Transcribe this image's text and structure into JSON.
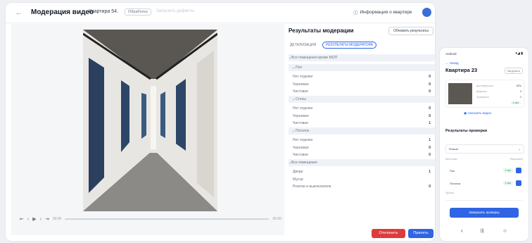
{
  "header": {
    "back_icon": "arrow-left-icon",
    "title": "Модерация видео",
    "breadcrumb": "Квартира 54.",
    "status_chip": "Обработка",
    "faded_text": "Загрузить дефекты",
    "info_label": "Информация о квартире"
  },
  "video": {
    "time_start": "00:00",
    "time_end": "00:00",
    "controls": [
      "⇤",
      "‹",
      "▶",
      "›",
      "⇥"
    ]
  },
  "panel": {
    "title": "Результаты модерации",
    "export_button": "Обновить результаты",
    "tabs": [
      "ДЕТАЛИЗАЦИЯ",
      "РЕЗУЛЬТАТЫ МОДЕРАТОРА"
    ],
    "rows": [
      {
        "label": "Все помещения кроме МОП",
        "value": "",
        "kind": "group"
      },
      {
        "label": "Пол",
        "value": "",
        "kind": "sub"
      },
      {
        "label": "Нет отделки",
        "value": "0",
        "kind": "item"
      },
      {
        "label": "Черновая",
        "value": "0",
        "kind": "item"
      },
      {
        "label": "Чистовая",
        "value": "0",
        "kind": "item"
      },
      {
        "label": "Стены",
        "value": "",
        "kind": "sub"
      },
      {
        "label": "Нет отделки",
        "value": "0",
        "kind": "item"
      },
      {
        "label": "Черновая",
        "value": "0",
        "kind": "item"
      },
      {
        "label": "Чистовая",
        "value": "1",
        "kind": "item"
      },
      {
        "label": "Потолок",
        "value": "",
        "kind": "sub"
      },
      {
        "label": "Нет отделки",
        "value": "1",
        "kind": "item"
      },
      {
        "label": "Черновая",
        "value": "0",
        "kind": "item"
      },
      {
        "label": "Чистовая",
        "value": "0",
        "kind": "item"
      },
      {
        "label": "Все помещения",
        "value": "",
        "kind": "group"
      },
      {
        "label": "Двери",
        "value": "1",
        "kind": "item"
      },
      {
        "label": "Мусор",
        "value": "",
        "kind": "item"
      },
      {
        "label": "Розетки и выключатели",
        "value": "0",
        "kind": "item"
      }
    ],
    "reject_button": "Отклонить",
    "accept_button": "Принять"
  },
  "phone": {
    "status_left": "Android",
    "status_right": "▾◢ ▮",
    "back_link": "← Назад",
    "title": "Квартира 23",
    "badge": "Загрузить",
    "card_lines": [
      {
        "label": "Достоверность",
        "value": "82%"
      },
      {
        "label": "Дефекты",
        "value": "3"
      },
      {
        "label": "Проверено",
        "value": "2"
      }
    ],
    "card_pill": "1 час",
    "video_link": "Смотреть видео",
    "results_title": "Результаты проверки",
    "select_label": "Ремонт",
    "table_header_left": "Категории",
    "table_header_right": "Результаты",
    "items": [
      {
        "name": "Пол",
        "tag": "1 час"
      },
      {
        "name": "Потолок",
        "tag": "1 час"
      }
    ],
    "note": "Прочее",
    "submit_button": "Завершить проверку",
    "nav": [
      "‹",
      "|||",
      "○"
    ]
  }
}
